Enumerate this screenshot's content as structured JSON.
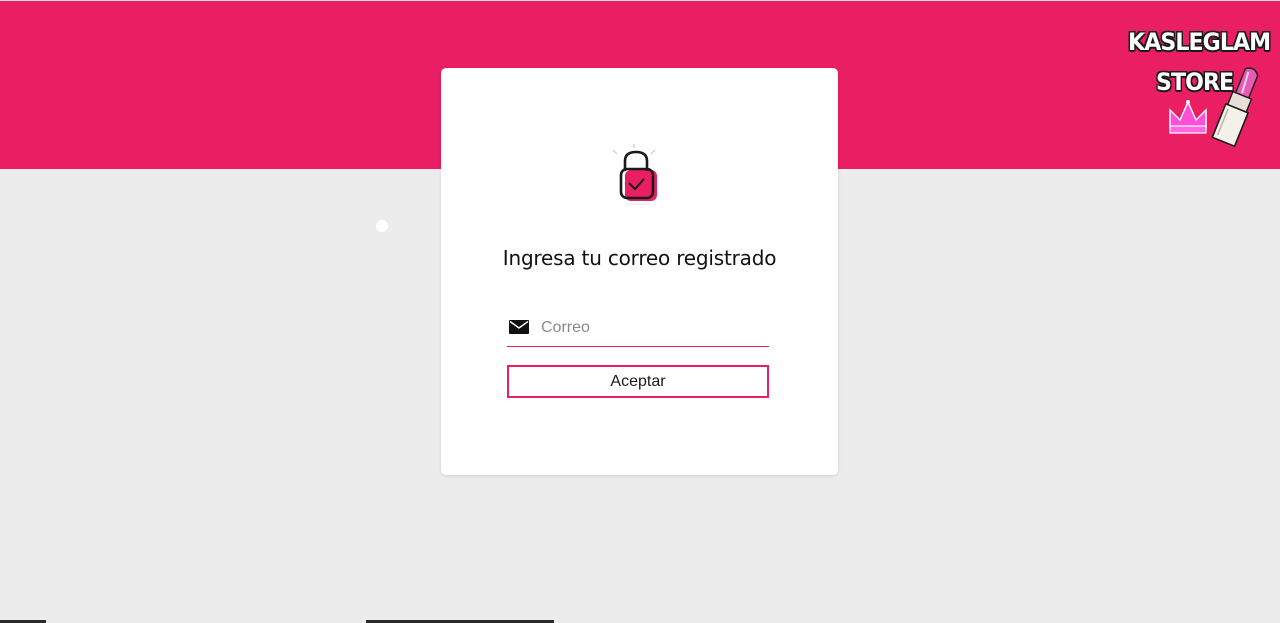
{
  "brand": {
    "logo_line1": "KASLEGLAM",
    "logo_line2": "STORE",
    "primary_color": "#e91e63",
    "background_color": "#ececec"
  },
  "card": {
    "icon": "lock-check-icon",
    "title": "Ingresa tu correo registrado",
    "email": {
      "icon": "envelope-icon",
      "placeholder": "Correo",
      "value": ""
    },
    "submit_label": "Aceptar"
  }
}
